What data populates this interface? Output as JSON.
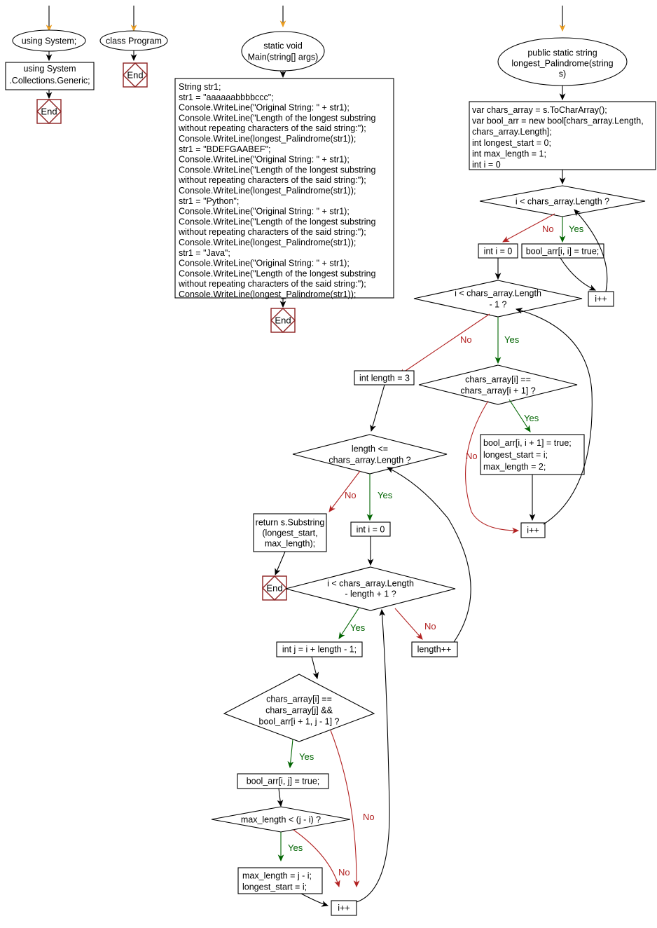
{
  "diagram": {
    "title": "C# flowchart: longest_Palindrome",
    "colors": {
      "start_marker": "#eb9e22",
      "yes": "#006400",
      "no": "#b22222",
      "end_border": "#8b2020",
      "node_border": "#000000",
      "background": "#ffffff"
    },
    "edge_labels": {
      "yes": "Yes",
      "no": "No"
    },
    "terminator_label": "End",
    "nodes": {
      "using_system": {
        "label": "using System;",
        "shape": "ellipse"
      },
      "using_collections": {
        "label": "using System\n.Collections.Generic;",
        "shape": "box"
      },
      "end_1": {
        "label": "End",
        "shape": "terminator"
      },
      "class_program": {
        "label": "class Program",
        "shape": "ellipse"
      },
      "end_2": {
        "label": "End",
        "shape": "terminator"
      },
      "main_header": {
        "label": "static void\nMain(string[] args)",
        "shape": "ellipse"
      },
      "main_body": {
        "shape": "box",
        "lines": [
          "String str1;",
          "str1 = \"aaaaaabbbbccc\";",
          "Console.WriteLine(\"Original String: \" + str1);",
          "Console.WriteLine(\"Length of the longest substring",
          "without repeating characters of the said string:\");",
          "Console.WriteLine(longest_Palindrome(str1));",
          "str1 = \"BDEFGAABEF\";",
          "Console.WriteLine(\"Original String: \" + str1);",
          "Console.WriteLine(\"Length of the longest substring",
          "without repeating characters of the said string:\");",
          "Console.WriteLine(longest_Palindrome(str1));",
          "str1 = \"Python\";",
          "Console.WriteLine(\"Original String: \" + str1);",
          "Console.WriteLine(\"Length of the longest substring",
          "without repeating characters of the said string:\");",
          "Console.WriteLine(longest_Palindrome(str1));",
          "str1 = \"Java\";",
          "Console.WriteLine(\"Original String: \" + str1);",
          "Console.WriteLine(\"Length of the longest substring",
          "without repeating characters of the said string:\");",
          "Console.WriteLine(longest_Palindrome(str1));"
        ]
      },
      "end_3": {
        "label": "End",
        "shape": "terminator"
      },
      "func_header": {
        "label": "public static string\nlongest_Palindrome(string\ns)",
        "shape": "ellipse"
      },
      "func_init": {
        "shape": "box",
        "lines": [
          "var chars_array = s.ToCharArray();",
          "var bool_arr = new bool[chars_array.Length,",
          "chars_array.Length];",
          "int longest_start = 0;",
          "int max_length = 1;",
          "int i = 0"
        ]
      },
      "cond_i_lt_len": {
        "label": "i < chars_array.Length ?",
        "shape": "diamond"
      },
      "int_i_0_a": {
        "label": "int i = 0",
        "shape": "box"
      },
      "bool_arr_ii": {
        "label": "bool_arr[i, i] = true;",
        "shape": "box"
      },
      "ipp_1": {
        "label": "i++",
        "shape": "box"
      },
      "cond_i_lt_len_m1": {
        "label": "i < chars_array.Length\n- 1 ?",
        "shape": "diamond"
      },
      "cond_chars_eq": {
        "label": "chars_array[i] ==\nchars_array[i + 1] ?",
        "shape": "diamond"
      },
      "set_pair": {
        "shape": "box",
        "lines": [
          "bool_arr[i, i + 1] = true;",
          "longest_start = i;",
          "max_length = 2;"
        ]
      },
      "ipp_2": {
        "label": "i++",
        "shape": "box"
      },
      "int_length_3": {
        "label": "int length = 3",
        "shape": "box"
      },
      "cond_length_le": {
        "label": "length <=\nchars_array.Length ?",
        "shape": "diamond"
      },
      "return_substring": {
        "label": "return s.Substring\n(longest_start,\nmax_length);",
        "shape": "box"
      },
      "end_4": {
        "label": "End",
        "shape": "terminator"
      },
      "int_i_0_b": {
        "label": "int i = 0",
        "shape": "box"
      },
      "cond_i_lt_len_length": {
        "label": "i < chars_array.Length\n- length + 1 ?",
        "shape": "diamond"
      },
      "length_pp": {
        "label": "length++",
        "shape": "box"
      },
      "int_j": {
        "label": "int j = i + length - 1;",
        "shape": "box"
      },
      "cond_chars_j": {
        "label": "chars_array[i] ==\nchars_array[j] &&\nbool_arr[i + 1, j - 1] ?",
        "shape": "diamond"
      },
      "bool_arr_ij": {
        "label": "bool_arr[i, j] = true;",
        "shape": "box"
      },
      "cond_max_length": {
        "label": "max_length < (j - i) ?",
        "shape": "diamond"
      },
      "set_max": {
        "label": "max_length = j - i;\nlongest_start = i;",
        "shape": "box"
      },
      "ipp_3": {
        "label": "i++",
        "shape": "box"
      }
    }
  }
}
